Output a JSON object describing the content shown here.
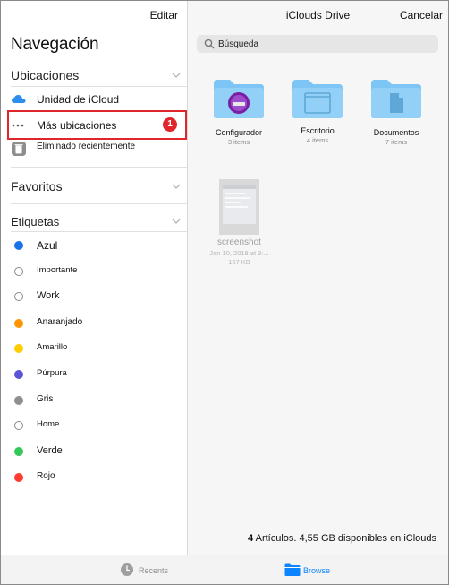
{
  "colors": {
    "accent": "#0a84ff",
    "highlight_red": "#e0262a",
    "folder_blue": "#7cc5f4",
    "sidebar_bg": "#ffffff",
    "main_bg": "#f6f6f6"
  },
  "sidebar": {
    "edit_label": "Editar",
    "title": "Navegación",
    "locations_header": "Ubicaciones",
    "locations": [
      {
        "label": "Unidad de iCloud",
        "icon": "icloud-icon"
      },
      {
        "label": "Más ubicaciones",
        "icon": "more-dots-icon",
        "badge": "1"
      },
      {
        "label": "Eliminado recientemente",
        "icon": "trash-icon"
      }
    ],
    "favorites_header": "Favoritos",
    "tags_header": "Etiquetas",
    "tags": [
      {
        "label": "Azul",
        "color": "#1a73e8"
      },
      {
        "label": "Importante",
        "color": ""
      },
      {
        "label": "Work",
        "color": ""
      },
      {
        "label": "Anaranjado",
        "color": "#ff9500"
      },
      {
        "label": "Amarillo",
        "color": "#ffcc00"
      },
      {
        "label": "Púrpura",
        "color": "#5856d6"
      },
      {
        "label": "Gris",
        "color": "#8e8e93"
      },
      {
        "label": "Home",
        "color": ""
      },
      {
        "label": "Verde",
        "color": "#34c759"
      },
      {
        "label": "Rojo",
        "color": "#ff3b30"
      }
    ]
  },
  "main": {
    "title": "iClouds Drive",
    "cancel_label": "Cancelar",
    "search_placeholder": "Búsqueda",
    "folders": [
      {
        "name": "Configurador",
        "count": "3 items",
        "icon": "configurator-app-icon"
      },
      {
        "name": "Escritorio",
        "count": "4 items",
        "icon": "desktop-window-icon"
      },
      {
        "name": "Documentos",
        "count": "7 items",
        "icon": "document-icon"
      }
    ],
    "file": {
      "name": "screenshot",
      "date": "Jan 10, 2018 at 3:...",
      "size": "167 KB"
    },
    "status_count": "4",
    "status_text": "Artículos. 4,55 GB disponibles en iClouds"
  },
  "tabbar": {
    "recents_label": "Recents",
    "browse_label": "Browse"
  }
}
